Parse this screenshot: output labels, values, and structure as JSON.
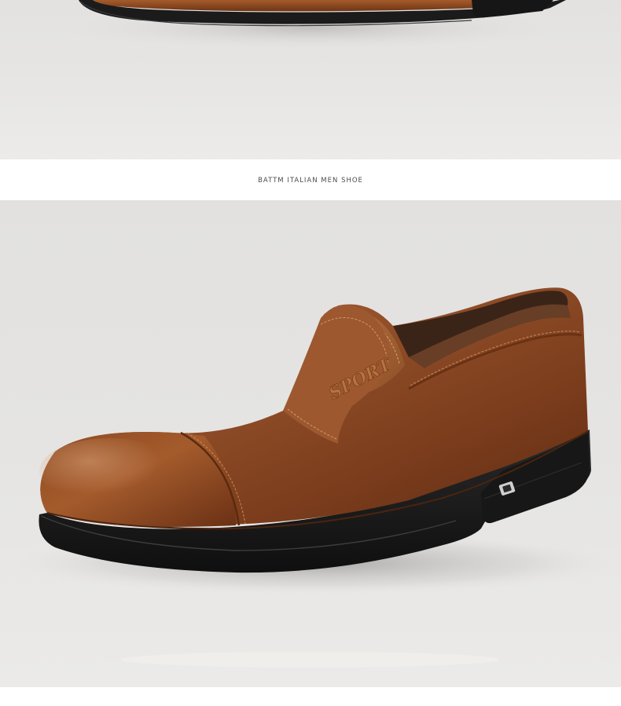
{
  "caption": "BATTM ITALIAN MEN SHOE",
  "logo_text": "SPORT",
  "colors": {
    "background": "#e4e3e1",
    "leather": "#8b4a22",
    "sole": "#1c1c1c"
  }
}
